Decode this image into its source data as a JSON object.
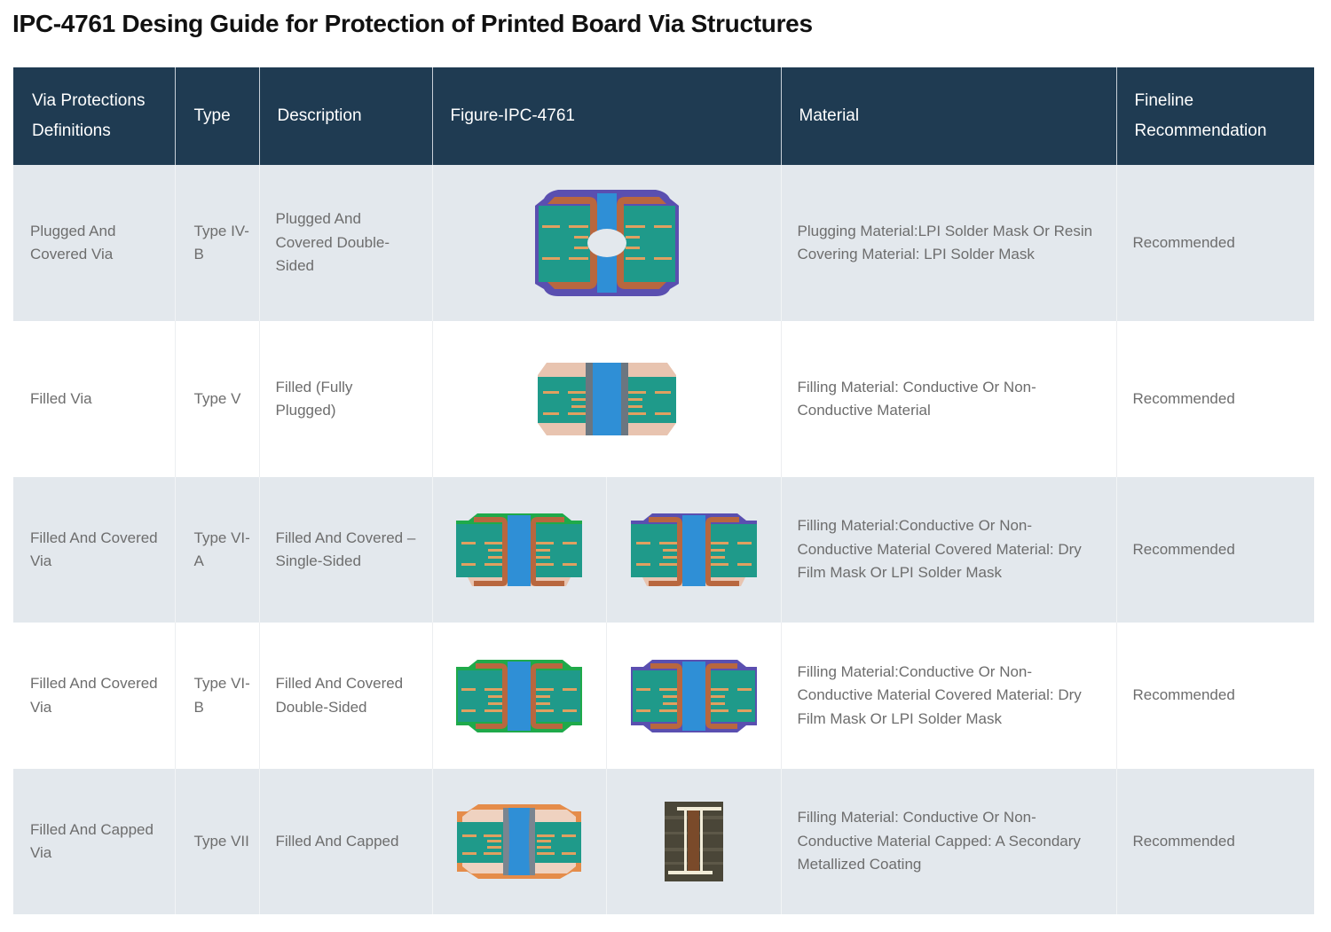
{
  "title": "IPC-4761 Desing Guide for Protection of Printed Board Via Structures",
  "colors": {
    "header_bg": "#1f3b52",
    "row_shade": "#e3e8ed",
    "laminate": "#1f9a8a",
    "copper": "#b8673f",
    "fill": "#2f8fd6",
    "mask_purple": "#5a4fb0",
    "mask_green": "#1faa4a",
    "cap_orange": "#e58c4a"
  },
  "table": {
    "headers": [
      "Via Protections Definitions",
      "Type",
      "Description",
      "Figure-IPC-4761",
      "Material",
      "Fineline Recommendation"
    ],
    "rows": [
      {
        "definition": "Plugged And Covered Via",
        "type": "Type IV-B",
        "description": "Plugged And Covered Double-Sided",
        "figures": [
          "plugged-covered-double-sided-via-figure"
        ],
        "material": "Plugging Material:LPI Solder Mask Or Resin Covering Material: LPI Solder Mask",
        "recommendation": "Recommended"
      },
      {
        "definition": "Filled Via",
        "type": "Type V",
        "description": "Filled (Fully Plugged)",
        "figures": [
          "filled-via-figure"
        ],
        "material": "Filling Material: Conductive Or Non-Conductive Material",
        "recommendation": "Recommended"
      },
      {
        "definition": "Filled And Covered Via",
        "type": "Type VI-A",
        "description": "Filled And Covered – Single-Sided",
        "figures": [
          "filled-covered-single-sided-green-mask-figure",
          "filled-covered-single-sided-purple-mask-figure"
        ],
        "material": "Filling Material:Conductive Or Non-Conductive Material Covered Material: Dry Film Mask Or LPI Solder Mask",
        "recommendation": "Recommended"
      },
      {
        "definition": "Filled And Covered Via",
        "type": "Type VI-B",
        "description": "Filled And Covered Double-Sided",
        "figures": [
          "filled-covered-double-sided-green-mask-figure",
          "filled-covered-double-sided-purple-mask-figure"
        ],
        "material": "Filling Material:Conductive Or Non-Conductive Material Covered Material: Dry Film Mask Or LPI Solder Mask",
        "recommendation": "Recommended"
      },
      {
        "definition": "Filled And Capped Via",
        "type": "Type VII",
        "description": "Filled And Capped",
        "figures": [
          "filled-capped-via-figure",
          "filled-capped-via-cross-section-photo"
        ],
        "material": "Filling Material: Conductive Or Non-Conductive Material Capped: A Secondary Metallized Coating",
        "recommendation": "Recommended"
      }
    ]
  }
}
